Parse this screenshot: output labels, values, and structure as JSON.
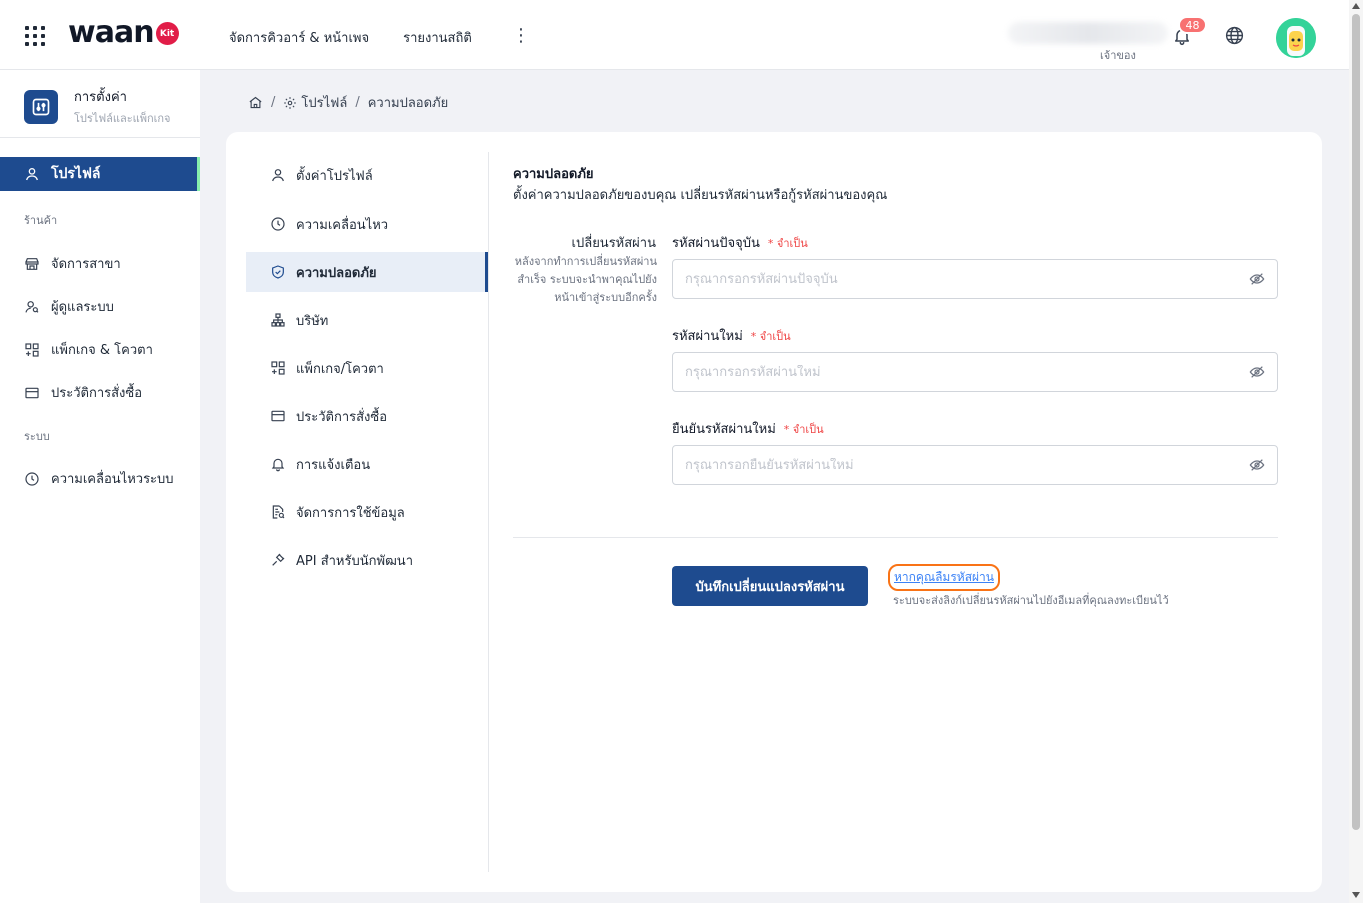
{
  "topbar": {
    "logo_text": "waan",
    "logo_badge": "Kit",
    "nav": [
      "จัดการคิวอาร์ & หน้าเพจ",
      "รายงานสถิติ"
    ],
    "more_icon": "kebab-icon",
    "owner_label": "เจ้าของ",
    "notification_count": "48",
    "notification_icon": "bell-icon",
    "language_icon": "globe-icon"
  },
  "sidebar": {
    "title": "การตั้งค่า",
    "subtitle": "โปรไฟล์และแพ็กเกจ",
    "active_item": "โปรไฟล์",
    "section_store": "ร้านค้า",
    "store_items": [
      "จัดการสาขา",
      "ผู้ดูแลระบบ",
      "แพ็กเกจ & โควตา",
      "ประวัติการสั่งซื้อ"
    ],
    "section_system": "ระบบ",
    "system_items": [
      "ความเคลื่อนไหวระบบ"
    ]
  },
  "breadcrumb": {
    "home_icon": "home-icon",
    "profile": "โปรไฟล์",
    "current": "ความปลอดภัย"
  },
  "settings_menu": [
    "ตั้งค่าโปรไฟล์",
    "ความเคลื่อนไหว",
    "ความปลอดภัย",
    "บริษัท",
    "แพ็กเกจ/โควตา",
    "ประวัติการสั่งซื้อ",
    "การแจ้งเตือน",
    "จัดการการใช้ข้อมูล",
    "API สำหรับนักพัฒนา"
  ],
  "security": {
    "title": "ความปลอดภัย",
    "description": "ตั้งค่าความปลอดภัยของบคุณ เปลี่ยนรหัสผ่านหรือกู้รหัสผ่านของคุณ",
    "change_label": "เปลี่ยนรหัสผ่าน",
    "change_help": "หลังจากทำการเปลี่ยนรหัสผ่านสำเร็จ ระบบจะนำพาคุณไปยังหน้าเข้าสู่ระบบอีกครั้ง",
    "required": "* จำเป็น",
    "current_label": "รหัสผ่านปัจจุบัน",
    "current_placeholder": "กรุณากรอกรหัสผ่านปัจจุบัน",
    "new_label": "รหัสผ่านใหม่",
    "new_placeholder": "กรุณากรอกรหัสผ่านใหม่",
    "confirm_label": "ยืนยันรหัสผ่านใหม่",
    "confirm_placeholder": "กรุณากรอกยืนยันรหัสผ่านใหม่",
    "save_button": "บันทึกเปลี่ยนแปลงรหัสผ่าน",
    "forgot_link": "หากคุณลืมรหัสผ่าน",
    "forgot_hint": "ระบบจะส่งลิงก์เปลี่ยนรหัสผ่านไปยังอีเมลที่คุณลงทะเบียนไว้"
  },
  "colors": {
    "primary": "#1e4b8f",
    "accent_green": "#86efac",
    "badge_red": "#f87171",
    "link_blue": "#3b82f6",
    "highlight_orange": "#f97316"
  }
}
